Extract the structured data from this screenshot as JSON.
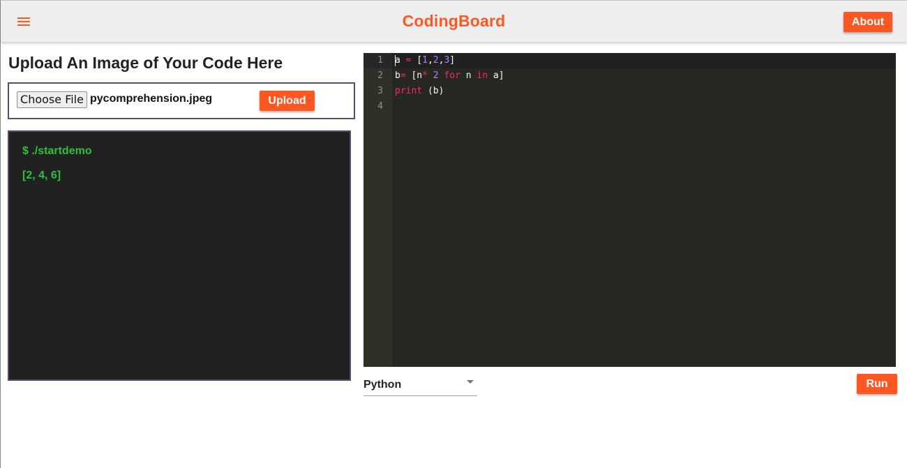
{
  "header": {
    "title": "CodingBoard",
    "about_label": "About",
    "menu_icon": "hamburger-menu-icon"
  },
  "upload": {
    "heading": "Upload An Image of Your Code Here",
    "choose_file_label": "Choose File",
    "file_name": "pycomprehension.jpeg",
    "upload_label": "Upload"
  },
  "terminal": {
    "command": "$ ./startdemo",
    "output": "[2, 4, 6]"
  },
  "editor": {
    "line_numbers": [
      "1",
      "2",
      "3",
      "4"
    ],
    "lines": [
      "a = [1,2,3]",
      "b= [n* 2 for n in a]",
      "print (b)",
      ""
    ],
    "theme_colors": {
      "background": "#272822",
      "keyword": "#f92672",
      "number": "#ae81ff",
      "text": "#f8f8f2"
    }
  },
  "controls": {
    "language": "Python",
    "run_label": "Run"
  },
  "colors": {
    "accent": "#ff5722",
    "terminal_bg": "#212121",
    "terminal_text": "#2fbf3c"
  }
}
